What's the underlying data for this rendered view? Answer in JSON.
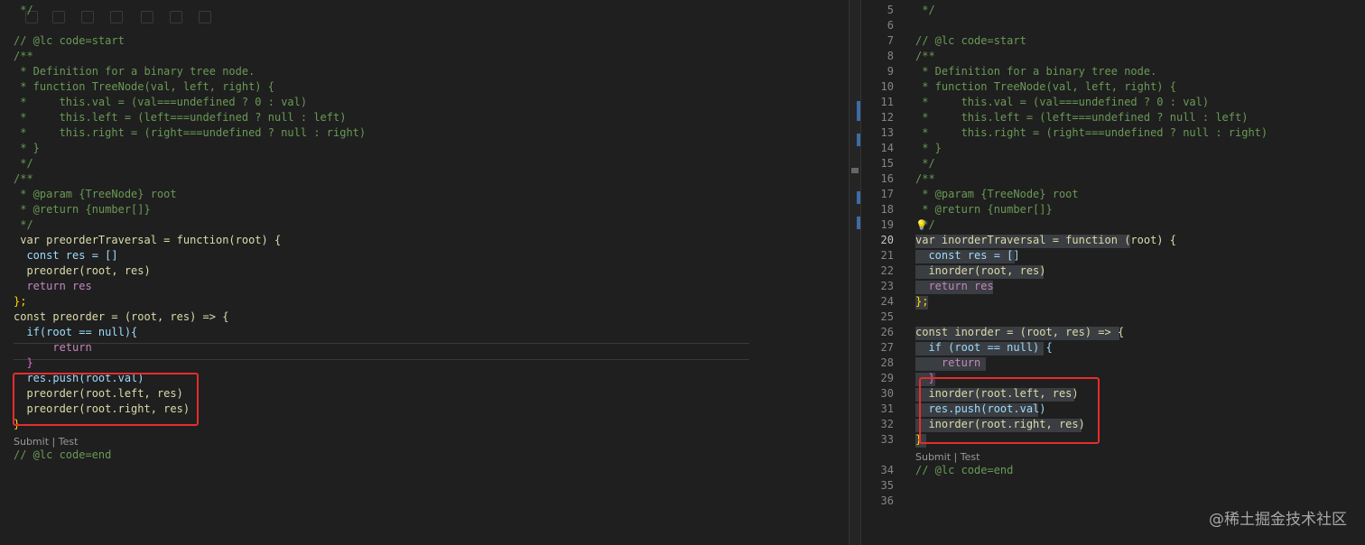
{
  "left": {
    "lines": [
      {
        "text": " */"
      },
      {
        "text": "// @lc code=start"
      },
      {
        "text": "/**"
      },
      {
        "text": " * Definition for a binary tree node."
      },
      {
        "text": " * function TreeNode(val, left, right) {"
      },
      {
        "text": " *     this.val = (val===undefined ? 0 : val)"
      },
      {
        "text": " *     this.left = (left===undefined ? null : left)"
      },
      {
        "text": " *     this.right = (right===undefined ? null : right)"
      },
      {
        "text": " * }"
      },
      {
        "text": " */"
      },
      {
        "text": "/**"
      },
      {
        "text": " * @param {TreeNode} root"
      },
      {
        "text": " * @return {number[]}"
      },
      {
        "text": " */"
      },
      {
        "text": " var preorderTraversal = function(root) {"
      },
      {
        "text": "  const res = []"
      },
      {
        "text": "  preorder(root, res)"
      },
      {
        "text": "  return res"
      },
      {
        "text": "};"
      },
      {
        "text": "const preorder = (root, res) => {"
      },
      {
        "text": "  if(root == null){"
      },
      {
        "text": "      return"
      },
      {
        "text": "  }"
      },
      {
        "text": "  res.push(root.val)"
      },
      {
        "text": "  preorder(root.left, res)"
      },
      {
        "text": "  preorder(root.right, res)"
      },
      {
        "text": "}"
      }
    ],
    "codelens": "Submit | Test",
    "last_line": "// @lc code=end"
  },
  "right": {
    "line_numbers": [
      "5",
      "6",
      "7",
      "8",
      "9",
      "10",
      "11",
      "12",
      "13",
      "14",
      "15",
      "16",
      "17",
      "18",
      "19",
      "20",
      "21",
      "22",
      "23",
      "24",
      "25",
      "26",
      "27",
      "28",
      "29",
      "30",
      "31",
      "32",
      "33",
      "34",
      "35",
      "36"
    ],
    "lines": [
      {
        "text": " */"
      },
      {
        "text": ""
      },
      {
        "text": "// @lc code=start"
      },
      {
        "text": "/**"
      },
      {
        "text": " * Definition for a binary tree node."
      },
      {
        "text": " * function TreeNode(val, left, right) {"
      },
      {
        "text": " *     this.val = (val===undefined ? 0 : val)"
      },
      {
        "text": " *     this.left = (left===undefined ? null : left)"
      },
      {
        "text": " *     this.right = (right===undefined ? null : right)"
      },
      {
        "text": " * }"
      },
      {
        "text": " */"
      },
      {
        "text": "/**"
      },
      {
        "text": " * @param {TreeNode} root"
      },
      {
        "text": " * @return {number[]}"
      },
      {
        "text": " */"
      },
      {
        "text": "var inorderTraversal = function (root) {"
      },
      {
        "text": "  const res = []"
      },
      {
        "text": "  inorder(root, res)"
      },
      {
        "text": "  return res"
      },
      {
        "text": "};"
      },
      {
        "text": ""
      },
      {
        "text": "const inorder = (root, res) => {"
      },
      {
        "text": "  if (root == null) {"
      },
      {
        "text": "    return"
      },
      {
        "text": "  }"
      },
      {
        "text": "  inorder(root.left, res)"
      },
      {
        "text": "  res.push(root.val)"
      },
      {
        "text": "  inorder(root.right, res)"
      },
      {
        "text": "}"
      }
    ],
    "codelens": "Submit | Test",
    "tail_lines": [
      "// @lc code=end",
      "",
      ""
    ]
  },
  "watermark": "@稀土掘金技术社区",
  "colors": {
    "background": "#1f1f1f",
    "highlight_box": "#e52d2d",
    "comment": "#6a9955",
    "keyword": "#569cd6",
    "function": "#dcdcaa",
    "variable": "#9cdcfe"
  }
}
